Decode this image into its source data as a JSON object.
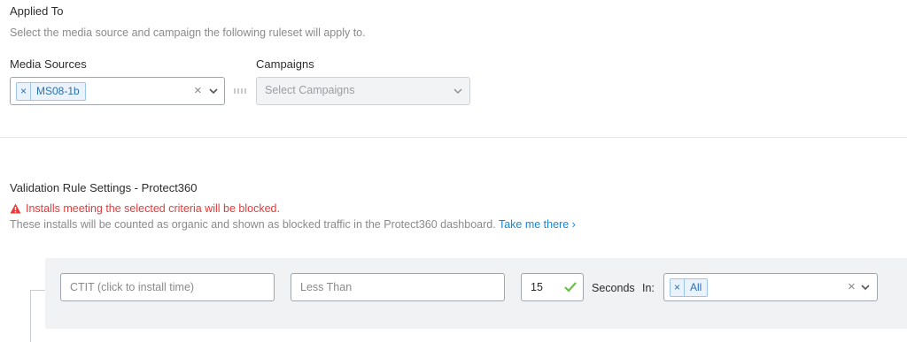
{
  "applied_to": {
    "title": "Applied To",
    "subtitle": "Select the media source and campaign the following ruleset will apply to.",
    "media_sources": {
      "label": "Media Sources",
      "tags": [
        "MS08-1b"
      ]
    },
    "campaigns": {
      "label": "Campaigns",
      "placeholder": "Select Campaigns"
    }
  },
  "validation": {
    "title": "Validation Rule Settings - Protect360",
    "warning": "Installs meeting the selected criteria will be blocked.",
    "description": "These installs will be counted as organic and shown as blocked traffic in the Protect360 dashboard.",
    "link": "Take me there",
    "link_chevron": "›"
  },
  "rule": {
    "metric_placeholder": "CTIT (click to install time)",
    "operator_placeholder": "Less Than",
    "value": "15",
    "unit_label": "Seconds",
    "in_label": "In:",
    "in_tags": [
      "All"
    ]
  },
  "icons": {
    "tag_remove": "×",
    "clear": "×",
    "warning": "⚠"
  },
  "colors": {
    "accent": "#1a86d0",
    "warning": "#e23b3b",
    "valid": "#6cc04a"
  }
}
